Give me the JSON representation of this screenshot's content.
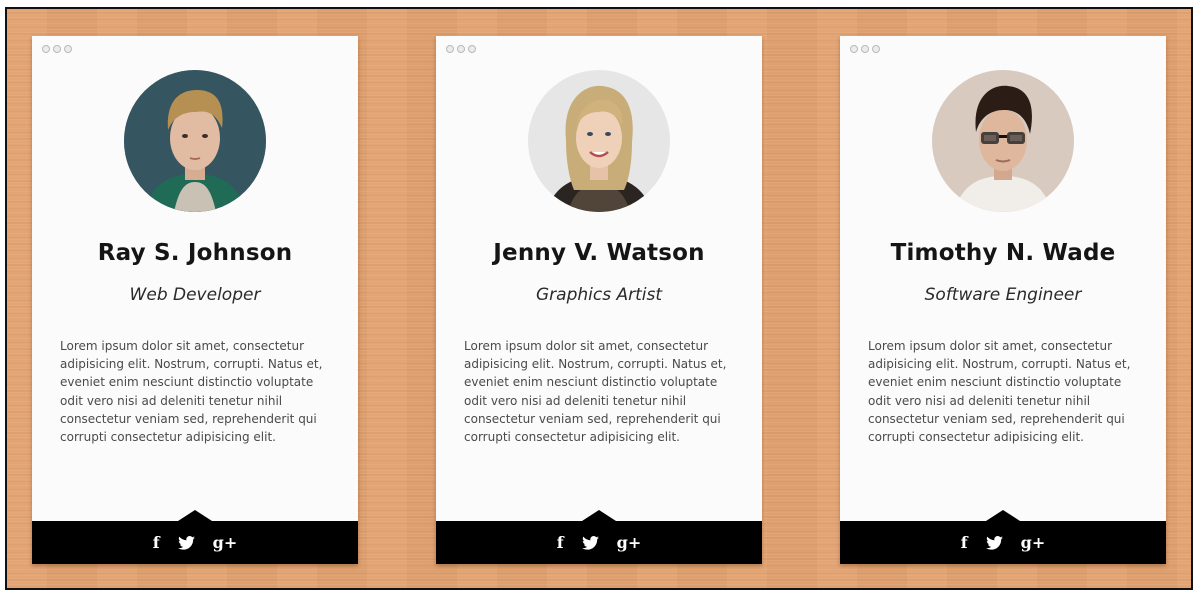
{
  "social": {
    "facebook_glyph": "f",
    "twitter_icon": "twitter-icon",
    "googleplus_glyph": "g+"
  },
  "cards": [
    {
      "name": "Ray S. Johnson",
      "role": "Web Developer",
      "bio": "Lorem ipsum dolor sit amet, consectetur adipisicing elit. Nostrum, corrupti. Natus et, eveniet enim nesciunt distinctio voluptate odit vero nisi ad deleniti tenetur nihil consectetur veniam sed, reprehenderit qui corrupti consectetur adipisicing elit."
    },
    {
      "name": "Jenny V. Watson",
      "role": "Graphics Artist",
      "bio": "Lorem ipsum dolor sit amet, consectetur adipisicing elit. Nostrum, corrupti. Natus et, eveniet enim nesciunt distinctio voluptate odit vero nisi ad deleniti tenetur nihil consectetur veniam sed, reprehenderit qui corrupti consectetur adipisicing elit."
    },
    {
      "name": "Timothy N. Wade",
      "role": "Software Engineer",
      "bio": "Lorem ipsum dolor sit amet, consectetur adipisicing elit. Nostrum, corrupti. Natus et, eveniet enim nesciunt distinctio voluptate odit vero nisi ad deleniti tenetur nihil consectetur veniam sed, reprehenderit qui corrupti consectetur adipisicing elit."
    }
  ],
  "colors": {
    "background_wood": "#e2a270",
    "card": "#fbfbfb",
    "footer": "#000000",
    "name_text": "#151515",
    "body_text": "#4a4a4a"
  }
}
